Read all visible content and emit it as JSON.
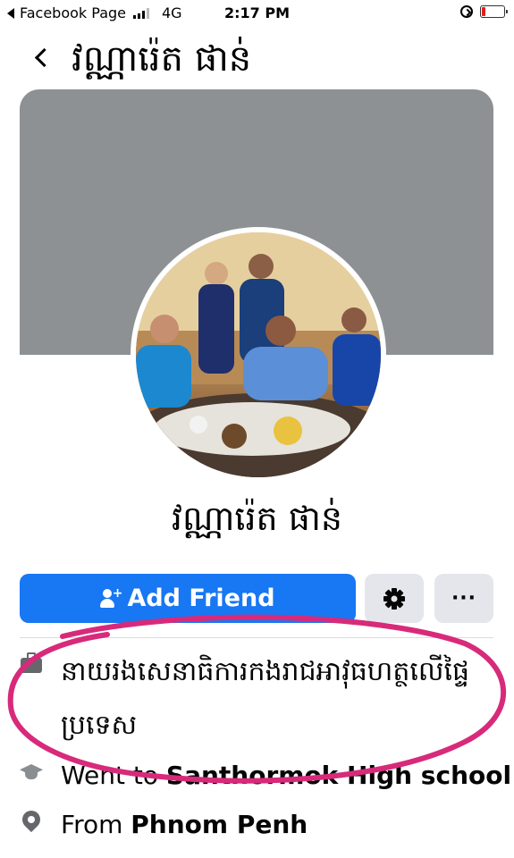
{
  "status_bar": {
    "carrier": "Facebook Page",
    "network": "4G",
    "time": "2:17 PM",
    "signal_bars": 3,
    "battery_level": 0.15,
    "battery_color": "#e02020"
  },
  "header": {
    "title": "វណ្ណារ៉េត ផាន់"
  },
  "profile": {
    "name": "វណ្ណារ៉េត ផាន់"
  },
  "actions": {
    "add_friend_label": "Add Friend",
    "settings_icon": "gear-icon",
    "more_label": "···"
  },
  "intro": {
    "work": "នាយរងសេនាធិការកងរាជអាវុធហត្ថលើផ្ទៃប្រទេស",
    "study_prefix": "Went to ",
    "study_school": "Santhormok High school",
    "from_prefix": "From ",
    "from_place": "Phnom Penh"
  },
  "colors": {
    "primary": "#1877f2",
    "cover": "#8d9194",
    "annotation": "#d82a7a"
  }
}
